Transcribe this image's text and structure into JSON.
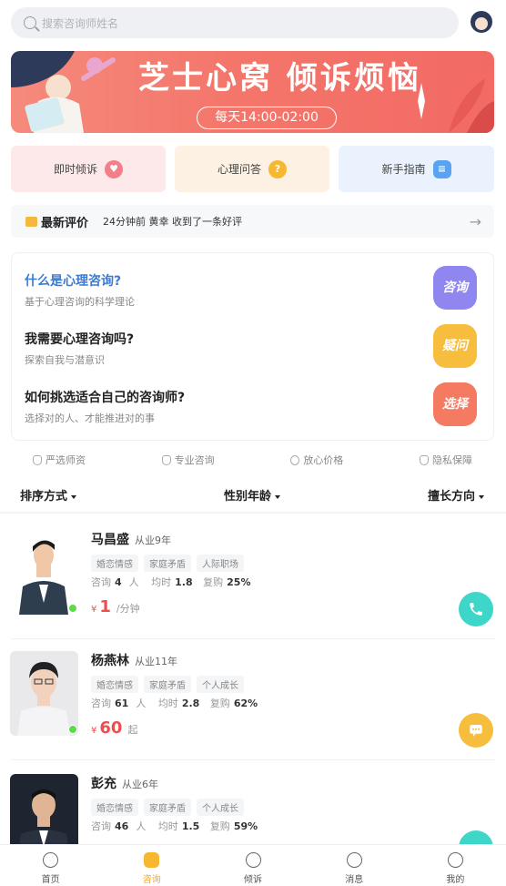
{
  "search": {
    "placeholder": "搜索咨询师姓名"
  },
  "banner": {
    "title": "芝士心窝 倾诉烦恼",
    "hours": "每天14:00-02:00"
  },
  "quick_actions": [
    {
      "label": "即时倾诉",
      "icon": "heart-chat-icon",
      "color": "#f37f8a"
    },
    {
      "label": "心理问答",
      "icon": "question-icon",
      "color": "#f7b731"
    },
    {
      "label": "新手指南",
      "icon": "guide-icon",
      "color": "#5aa3f2"
    }
  ],
  "review": {
    "title": "最新评价",
    "text": "24分钟前 黄幸 收到了一条好评"
  },
  "faq": [
    {
      "title": "什么是心理咨询?",
      "subtitle": "基于心理咨询的科学理论",
      "badge": "咨询",
      "title_color": "#3a7bd5",
      "badge_color": "#8f86f0"
    },
    {
      "title": "我需要心理咨询吗?",
      "subtitle": "探索自我与潜意识",
      "badge": "疑问",
      "title_color": "#222222",
      "badge_color": "#f7bd3c"
    },
    {
      "title": "如何挑选适合自己的咨询师?",
      "subtitle": "选择对的人、才能推进对的事",
      "badge": "选择",
      "title_color": "#222222",
      "badge_color": "#f47a62"
    }
  ],
  "assurances": [
    "严选师资",
    "专业咨询",
    "放心价格",
    "隐私保障"
  ],
  "filters": [
    "排序方式",
    "性别年龄",
    "擅长方向"
  ],
  "counselors": [
    {
      "name": "马昌盛",
      "years": "从业9年",
      "tags": [
        "婚恋情感",
        "家庭矛盾",
        "人际职场"
      ],
      "consult_label": "咨询",
      "consult": "4",
      "consult_unit": "人",
      "avg_label": "均时",
      "avg": "1.8",
      "repurchase_label": "复购",
      "repurchase": "25%",
      "currency": "¥",
      "price": "1",
      "price_unit": "/分钟",
      "action": "phone-icon",
      "action_color": "#3dd6c8"
    },
    {
      "name": "杨燕林",
      "years": "从业11年",
      "tags": [
        "婚恋情感",
        "家庭矛盾",
        "个人成长"
      ],
      "consult_label": "咨询",
      "consult": "61",
      "consult_unit": "人",
      "avg_label": "均时",
      "avg": "2.8",
      "repurchase_label": "复购",
      "repurchase": "62%",
      "currency": "¥",
      "price": "60",
      "price_unit": "起",
      "action": "message-icon",
      "action_color": "#f7bd3c"
    },
    {
      "name": "彭充",
      "years": "从业6年",
      "tags": [
        "婚恋情感",
        "家庭矛盾",
        "个人成长"
      ],
      "consult_label": "咨询",
      "consult": "46",
      "consult_unit": "人",
      "avg_label": "均时",
      "avg": "1.5",
      "repurchase_label": "复购",
      "repurchase": "59%",
      "currency": "¥",
      "price": "",
      "price_unit": "",
      "action": "phone-icon",
      "action_color": "#3dd6c8"
    }
  ],
  "nav": [
    {
      "label": "首页",
      "icon": "home-icon",
      "active": false
    },
    {
      "label": "咨询",
      "icon": "consult-icon",
      "active": true
    },
    {
      "label": "倾诉",
      "icon": "talk-icon",
      "active": false
    },
    {
      "label": "消息",
      "icon": "message-icon",
      "active": false
    },
    {
      "label": "我的",
      "icon": "profile-icon",
      "active": false
    }
  ]
}
